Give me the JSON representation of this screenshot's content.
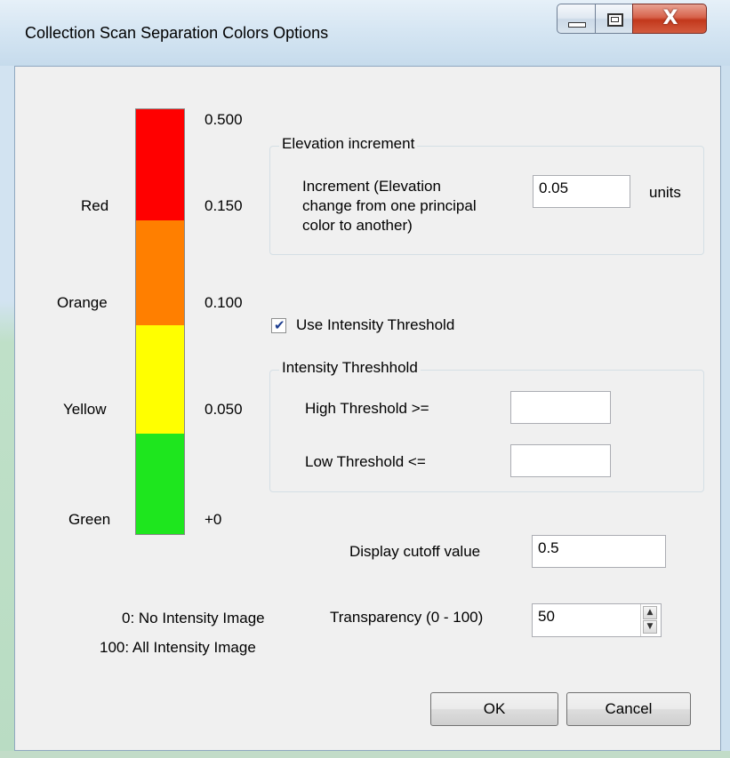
{
  "window": {
    "title": "Collection Scan Separation Colors Options",
    "minimize_icon": "minimize-icon",
    "maximize_icon": "maximize-icon",
    "close_icon": "close-icon",
    "close_glyph": "X"
  },
  "scale": {
    "segments": [
      {
        "color_name": "Red",
        "color": "#ff0000"
      },
      {
        "color_name": "Orange",
        "color": "#ff7f00"
      },
      {
        "color_name": "Yellow",
        "color": "#ffff00"
      },
      {
        "color_name": "Green",
        "color": "#1ee61e"
      }
    ],
    "values": [
      "0.500",
      "0.150",
      "0.100",
      "0.050",
      "+0"
    ]
  },
  "elevation": {
    "group_label": "Elevation increment",
    "increment_label_1": "Increment (Elevation",
    "increment_label_2": "change from one principal",
    "increment_label_3": "color to another)",
    "increment_value": "0.05",
    "units_label": "units"
  },
  "intensity": {
    "use_threshold_label": "Use Intensity Threshold",
    "use_threshold_checked": true,
    "group_label": "Intensity Threshhold",
    "high_label": "High Threshold  >=",
    "high_value": "",
    "low_label": "Low Threshold  <=",
    "low_value": ""
  },
  "display": {
    "cutoff_label": "Display cutoff value",
    "cutoff_value": "0.5",
    "transparency_label": "Transparency (0 - 100)",
    "transparency_value": "50",
    "note_0": "0: No Intensity Image",
    "note_100": "100: All Intensity Image"
  },
  "buttons": {
    "ok": "OK",
    "cancel": "Cancel"
  }
}
